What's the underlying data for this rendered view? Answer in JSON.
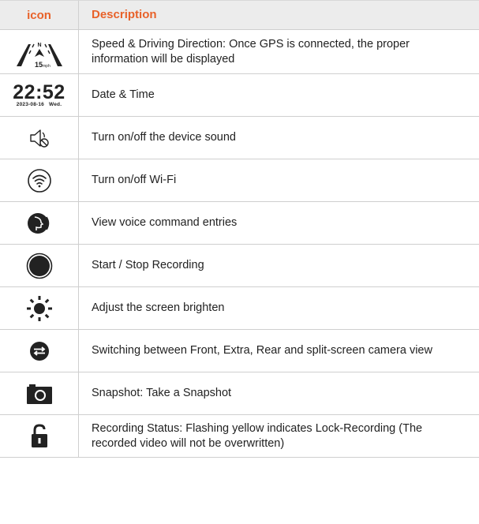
{
  "header": {
    "icon_col": "icon",
    "desc_col": "Description"
  },
  "rows": [
    {
      "icon": "speed-direction-icon",
      "icon_text": {
        "north": "N",
        "speed": "15",
        "unit": "mph"
      },
      "description": "Speed & Driving Direction: Once GPS is connected, the proper information will be displayed"
    },
    {
      "icon": "date-time-display",
      "icon_text": {
        "time": "22:52",
        "date": "2023-08-16",
        "day": "Wed."
      },
      "description": "Date & Time"
    },
    {
      "icon": "sound-toggle-icon",
      "description": "Turn on/off the device sound"
    },
    {
      "icon": "wifi-toggle-icon",
      "description": "Turn on/off Wi-Fi"
    },
    {
      "icon": "voice-command-icon",
      "description": "View voice command entries"
    },
    {
      "icon": "record-icon",
      "description": "Start / Stop Recording"
    },
    {
      "icon": "brightness-icon",
      "description": "Adjust the screen brighten"
    },
    {
      "icon": "camera-switch-icon",
      "description": "Switching between Front, Extra, Rear and split-screen camera view"
    },
    {
      "icon": "snapshot-icon",
      "description": "Snapshot: Take a Snapshot"
    },
    {
      "icon": "lock-icon",
      "description": "Recording Status: Flashing yellow indicates Lock-Recording (The recorded video will not be overwritten)"
    }
  ]
}
